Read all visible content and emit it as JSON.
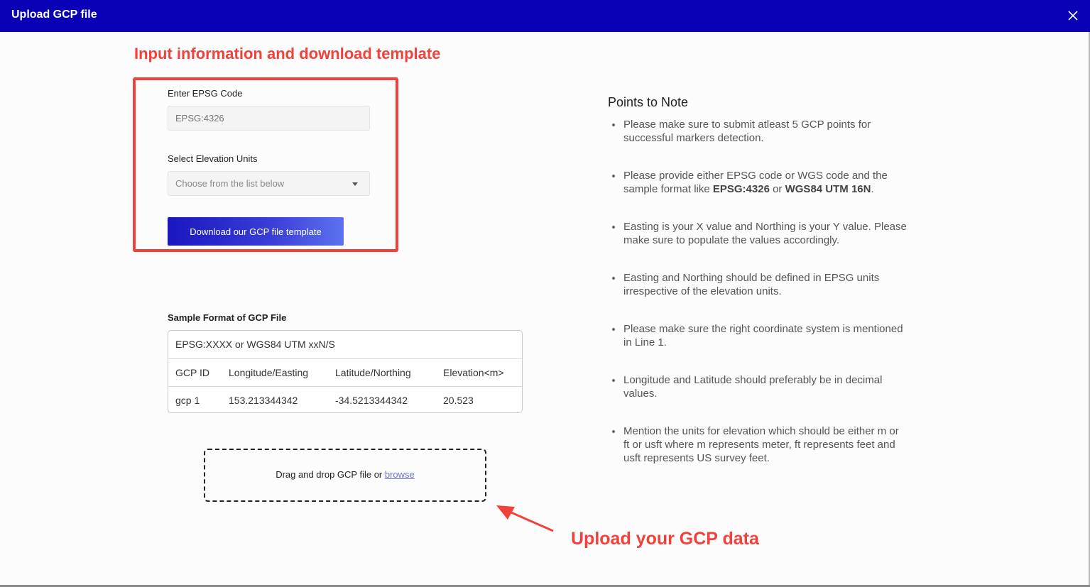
{
  "dialog": {
    "title": "Upload GCP file"
  },
  "annotations": {
    "top": "Input information and download template",
    "bottom": "Upload your GCP data",
    "color": "#f0413a"
  },
  "form": {
    "epsg_label": "Enter EPSG Code",
    "epsg_placeholder": "EPSG:4326",
    "elevation_label": "Select Elevation Units",
    "elevation_selected": "Choose from the list below",
    "download_button": "Download our GCP file template"
  },
  "sample": {
    "label": "Sample Format of GCP File",
    "header_line": "EPSG:XXXX or WGS84 UTM xxN/S",
    "columns": [
      "GCP ID",
      "Longitude/Easting",
      "Latitude/Northing",
      "Elevation<m>"
    ],
    "row": [
      "gcp 1",
      "153.213344342",
      "-34.5213344342",
      "20.523"
    ]
  },
  "dropzone": {
    "text": "Drag and drop GCP file or ",
    "link": "browse"
  },
  "notes": {
    "title": "Points to Note",
    "items": [
      "Please make sure to submit atleast 5 GCP points for successful markers detection.",
      "Please provide either EPSG code or WGS code and the sample format like ",
      "Easting is your X value and Northing is your Y value. Please make sure to populate the values accordingly.",
      "Easting and Northing should be defined in EPSG units irrespective of the elevation units.",
      "Please make sure the right coordinate system is mentioned in Line 1.",
      "Longitude and Latitude should preferably be in decimal values.",
      "Mention the units for elevation which should be either m or ft or usft where m represents meter, ft represents feet and usft represents US survey feet."
    ],
    "item2_bold1": "EPSG:4326",
    "item2_mid": " or ",
    "item2_bold2": "WGS84 UTM 16N",
    "item2_end": "."
  },
  "icons": {
    "close": "close-icon",
    "dropdown": "chevron-down-icon",
    "arrow": "arrow-annotation-icon"
  },
  "colors": {
    "header_bg": "#0a00b6",
    "button_start": "#1a16c0",
    "button_end": "#5c72ef"
  }
}
